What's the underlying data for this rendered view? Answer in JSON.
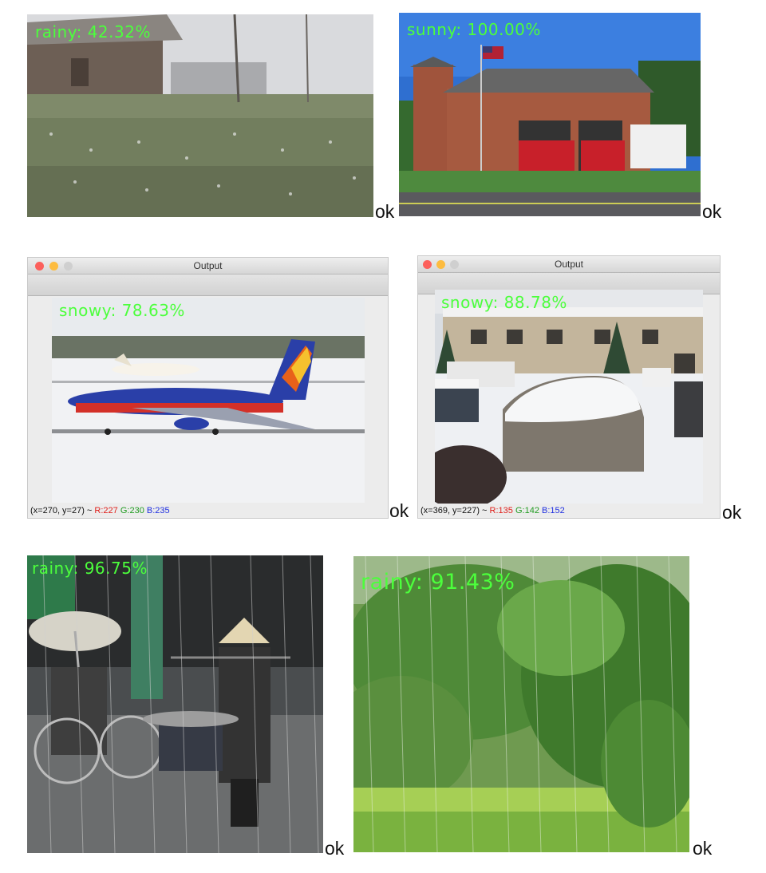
{
  "panels": [
    {
      "prediction": "rainy: 42.32%",
      "ok": "ok"
    },
    {
      "prediction": "sunny: 100.00%",
      "ok": "ok"
    },
    {
      "prediction": "snowy: 78.63%",
      "ok": "ok",
      "window": {
        "title": "Output",
        "status": {
          "coords": "(x=270, y=27) ~",
          "r": "R:227",
          "g": "G:230",
          "b": "B:235"
        }
      }
    },
    {
      "prediction": "snowy: 88.78%",
      "ok": "ok",
      "window": {
        "title": "Output",
        "status": {
          "coords": "(x=369, y=227) ~",
          "r": "R:135",
          "g": "G:142",
          "b": "B:152"
        }
      }
    },
    {
      "prediction": "rainy: 96.75%",
      "ok": "ok"
    },
    {
      "prediction": "rainy: 91.43%",
      "ok": "ok"
    }
  ],
  "colors": {
    "prediction_text": "#4cff3c",
    "traffic_close": "#fc605c",
    "traffic_minimize": "#fdbc40",
    "traffic_zoom": "#cfcfcf"
  }
}
